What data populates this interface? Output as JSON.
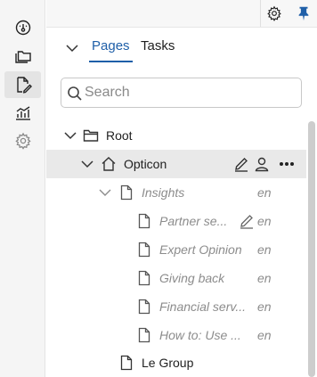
{
  "sidebar": {
    "items": [
      {
        "icon": "dashboard-gauge-icon"
      },
      {
        "icon": "folders-icon"
      },
      {
        "icon": "edit-document-icon",
        "active": true
      },
      {
        "icon": "analytics-chart-icon"
      },
      {
        "icon": "settings-gear-icon"
      }
    ]
  },
  "toolbar": {
    "settings_icon": "gear-icon",
    "pin_icon": "pin-icon",
    "pin_color": "#1f5fa8"
  },
  "tabs": {
    "items": [
      {
        "label": "Pages",
        "active": true
      },
      {
        "label": "Tasks",
        "active": false
      }
    ]
  },
  "search": {
    "placeholder": "Search",
    "value": ""
  },
  "tree": {
    "rows": [
      {
        "label": "Root",
        "type": "folder",
        "level": 0,
        "expanded": true
      },
      {
        "label": "Opticon",
        "type": "home",
        "level": 1,
        "expanded": true,
        "selected": true
      },
      {
        "label": "Insights",
        "type": "page",
        "level": 2,
        "expanded": true,
        "lang": "en",
        "muted": true
      },
      {
        "label": "Partner se...",
        "type": "page",
        "level": 3,
        "lang": "en",
        "muted": true,
        "editing": true
      },
      {
        "label": "Expert Opinion",
        "type": "page",
        "level": 3,
        "lang": "en",
        "muted": true
      },
      {
        "label": "Giving back",
        "type": "page",
        "level": 3,
        "lang": "en",
        "muted": true
      },
      {
        "label": "Financial serv...",
        "type": "page",
        "level": 3,
        "lang": "en",
        "muted": true
      },
      {
        "label": "How to: Use ...",
        "type": "page",
        "level": 3,
        "lang": "en",
        "muted": true
      },
      {
        "label": "Le Group",
        "type": "page",
        "level": 2
      }
    ]
  },
  "colors": {
    "accent": "#1f5fa8",
    "muted_text": "#8c8c8c",
    "selected_row": "#e9e9e9"
  }
}
